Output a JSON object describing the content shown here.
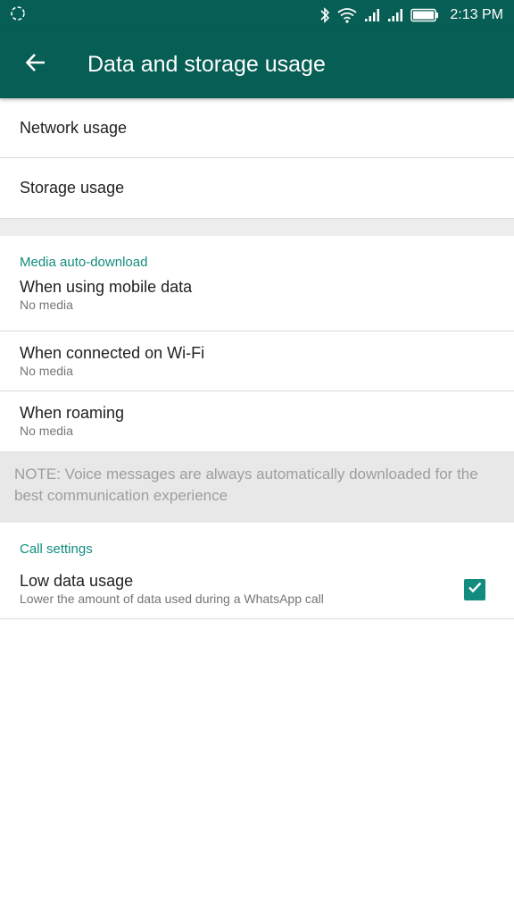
{
  "status_bar": {
    "time": "2:13 PM",
    "icons": [
      "sync-icon",
      "bluetooth-icon",
      "wifi-icon",
      "signal-icon",
      "signal-icon",
      "battery-icon"
    ]
  },
  "app_bar": {
    "title": "Data and storage usage",
    "back_icon": "back-arrow-icon"
  },
  "storage_items": [
    {
      "label": "Network usage"
    },
    {
      "label": "Storage usage"
    }
  ],
  "media_auto_download": {
    "header": "Media auto-download",
    "items": [
      {
        "title": "When using mobile data",
        "subtitle": "No media"
      },
      {
        "title": "When connected on Wi-Fi",
        "subtitle": "No media"
      },
      {
        "title": "When roaming",
        "subtitle": "No media"
      }
    ],
    "note": "NOTE: Voice messages are always automatically downloaded for the best communication experience"
  },
  "call_settings": {
    "header": "Call settings",
    "low_data": {
      "title": "Low data usage",
      "subtitle": "Lower the amount of data used during a WhatsApp call",
      "checked": true
    }
  },
  "colors": {
    "toolbar": "#075e54",
    "accent": "#128c7e"
  }
}
